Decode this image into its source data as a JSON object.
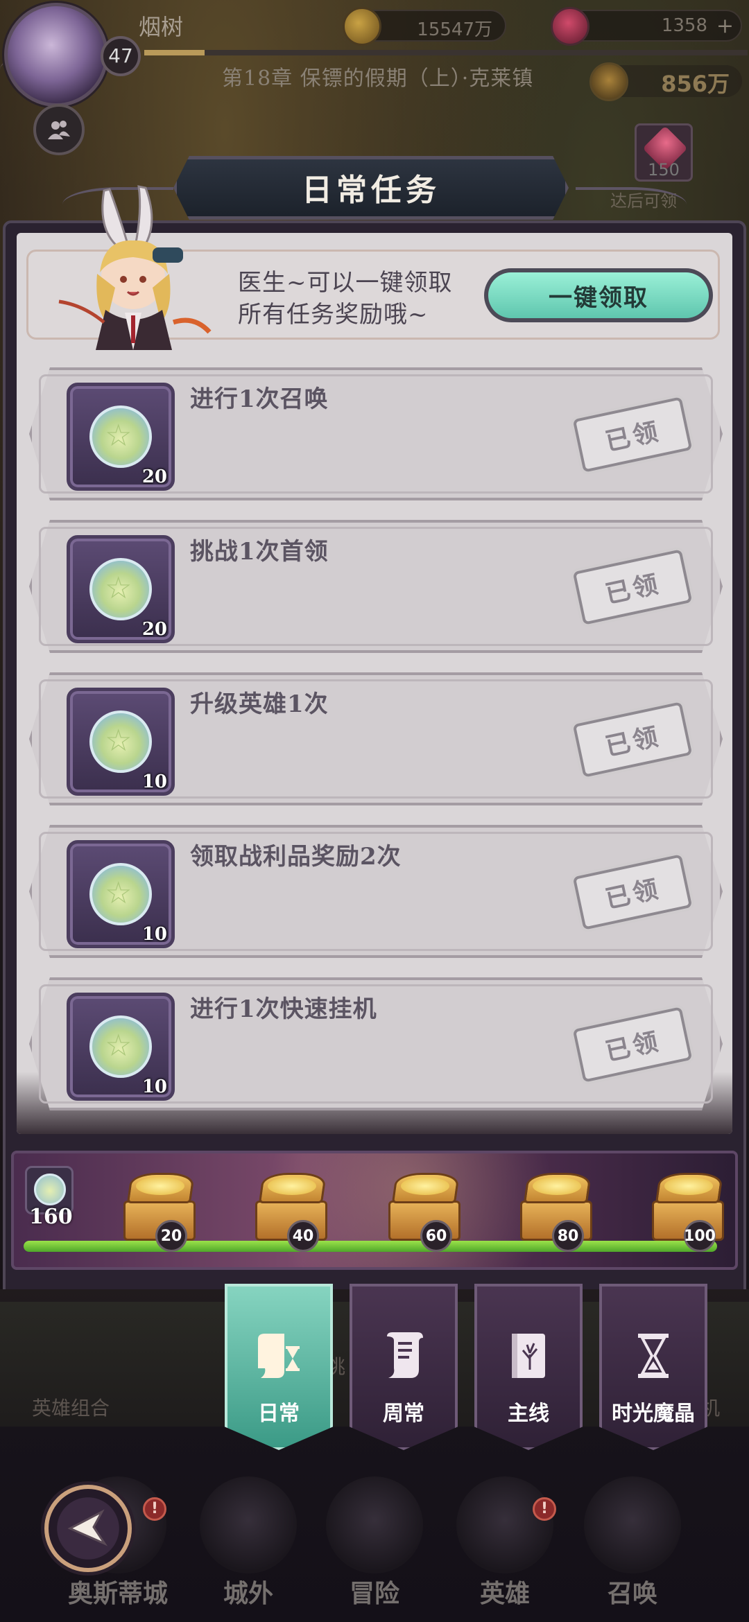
{
  "hud": {
    "player_name": "烟树",
    "level": "47",
    "exp_progress": 0.1,
    "chapter": "第18章 保镖的假期（上）·克莱镇",
    "gold": "15547万",
    "gems": "1358",
    "gems_plus": "+",
    "idle_gold": "856万",
    "pack_count": "150",
    "pack_text": "达后可领"
  },
  "panel": {
    "title": "日常任务",
    "helper_text_line1": "医生~可以一键领取",
    "helper_text_line2": "所有任务奖励哦~",
    "claim_all_label": "一键领取"
  },
  "tasks": [
    {
      "name": "进行1次召唤",
      "reward_qty": "20",
      "status": "已领"
    },
    {
      "name": "挑战1次首领",
      "reward_qty": "20",
      "status": "已领"
    },
    {
      "name": "升级英雄1次",
      "reward_qty": "10",
      "status": "已领"
    },
    {
      "name": "领取战利品奖励2次",
      "reward_qty": "10",
      "status": "已领"
    },
    {
      "name": "进行1次快速挂机",
      "reward_qty": "10",
      "status": "已领"
    }
  ],
  "progress": {
    "points": "160",
    "fill_fraction": 1.0,
    "milestones": [
      "20",
      "40",
      "60",
      "80",
      "100"
    ]
  },
  "tabs": [
    {
      "label": "日常",
      "icon": "scroll-hourglass-icon",
      "active": true
    },
    {
      "label": "周常",
      "icon": "scroll-icon",
      "active": false
    },
    {
      "label": "主线",
      "icon": "book-tree-icon",
      "active": false
    },
    {
      "label": "时光魔晶",
      "icon": "hourglass-icon",
      "active": false
    }
  ],
  "background": {
    "hero_combo_label": "英雄组合",
    "partial_left": "挑",
    "partial_right": "机"
  },
  "nav": [
    {
      "label": "奥斯蒂城",
      "alert": true
    },
    {
      "label": "城外",
      "alert": false
    },
    {
      "label": "冒险",
      "alert": false
    },
    {
      "label": "英雄",
      "alert": true
    },
    {
      "label": "召唤",
      "alert": false
    }
  ],
  "alert_mark": "!",
  "colors": {
    "accent_teal": "#5fc6ae",
    "progress_green": "#7fcf3a",
    "panel_purple": "#4b3d5e"
  }
}
